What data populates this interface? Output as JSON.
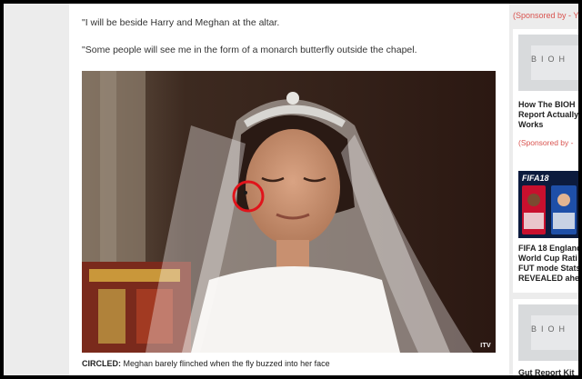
{
  "article": {
    "quote1": "\"I will be beside Harry and Meghan at the altar.",
    "quote2": "\"Some people will see me in the form of a monarch butterfly outside the chapel.",
    "photo_watermark": "ITV",
    "caption_label": "CIRCLED:",
    "caption_text": " Meghan barely flinched when the fly buzzed into her face"
  },
  "sidebar": {
    "sponsored_top": "(Sponsored by - Y",
    "cards": [
      {
        "logo": "BIOH",
        "title_line1": "How The BIOH",
        "title_line2": "Report Actually",
        "title_line3": "Works",
        "sponsor": "(Sponsored by -"
      },
      {
        "logo": "FIFA18",
        "title_line1": "FIFA 18 England",
        "title_line2": "World Cup Rati",
        "title_line3": "FUT mode Stats",
        "title_line4": "REVEALED ahe"
      },
      {
        "logo": "BIOH",
        "title_line1": "Gut Report Kit"
      }
    ]
  },
  "colors": {
    "sponsor_red": "#d9534f",
    "annotation_circle": "#e0141b"
  }
}
